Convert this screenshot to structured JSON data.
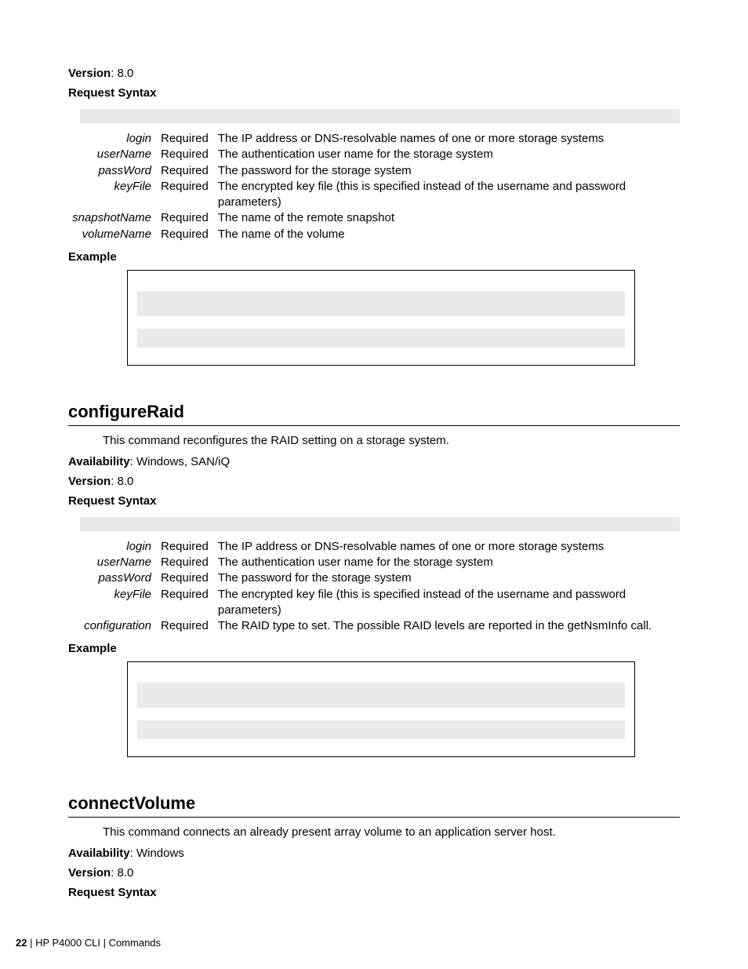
{
  "section_top": {
    "version_label": "Version",
    "version_value": ": 8.0",
    "request_syntax": "Request Syntax",
    "params": [
      {
        "name": "login",
        "req": "Required",
        "desc": "The IP address or DNS-resolvable names of one or more storage systems"
      },
      {
        "name": "userName",
        "req": "Required",
        "desc": "The authentication user name for the storage system"
      },
      {
        "name": "passWord",
        "req": "Required",
        "desc": "The password for the storage system"
      },
      {
        "name": "keyFile",
        "req": "Required",
        "desc": "The encrypted key file (this is specified instead of the username and password parameters)"
      },
      {
        "name": "snapshotName",
        "req": "Required",
        "desc": "The name of the remote snapshot"
      },
      {
        "name": "volumeName",
        "req": "Required",
        "desc": "The name of the volume"
      }
    ],
    "example_label": "Example"
  },
  "section_configureRaid": {
    "heading": "configureRaid",
    "description": "This command reconfigures the RAID setting on a storage system.",
    "availability_label": "Availability",
    "availability_value": ": Windows, SAN/iQ",
    "version_label": "Version",
    "version_value": ": 8.0",
    "request_syntax": "Request Syntax",
    "params": [
      {
        "name": "login",
        "req": "Required",
        "desc": "The IP address or DNS-resolvable names of one or more storage systems"
      },
      {
        "name": "userName",
        "req": "Required",
        "desc": "The authentication user name for the storage system"
      },
      {
        "name": "passWord",
        "req": "Required",
        "desc": "The password for the storage system"
      },
      {
        "name": "keyFile",
        "req": "Required",
        "desc": "The encrypted key file (this is specified instead of the username and password parameters)"
      },
      {
        "name": "configuration",
        "req": "Required",
        "desc": "The RAID type to set. The possible RAID levels are reported in the getNsmInfo call."
      }
    ],
    "example_label": "Example"
  },
  "section_connectVolume": {
    "heading": "connectVolume",
    "description": "This command connects an already present array volume to an application server host.",
    "availability_label": "Availability",
    "availability_value": ": Windows",
    "version_label": "Version",
    "version_value": ": 8.0",
    "request_syntax": "Request Syntax"
  },
  "footer": {
    "page": "22",
    "sep1": " | ",
    "product": "HP P4000 CLI",
    "sep2": " | ",
    "section": "Commands"
  }
}
